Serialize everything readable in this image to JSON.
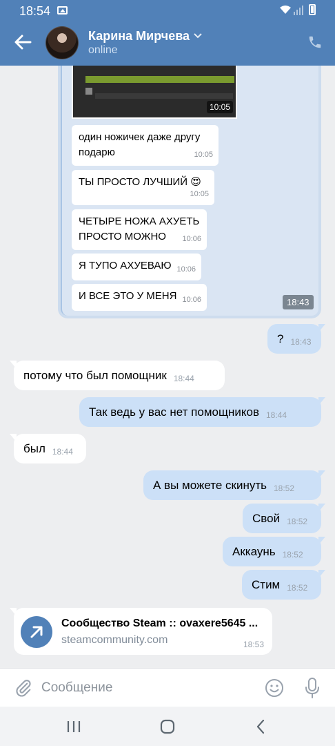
{
  "status_bar": {
    "time": "18:54"
  },
  "header": {
    "contact_name": "Карина Мирчева",
    "status": "online"
  },
  "forwarded": {
    "screenshot_time": "10:05",
    "messages": [
      {
        "text": "один ножичек даже другу подарю",
        "time": "10:05"
      },
      {
        "text": "ТЫ ПРОСТО ЛУЧШИЙ 😍",
        "time": "10:05"
      },
      {
        "text": "ЧЕТЫРЕ НОЖА АХУЕТЬ ПРОСТО МОЖНО",
        "time": "10:06"
      },
      {
        "text": "Я ТУПО АХУЕВАЮ",
        "time": "10:06"
      },
      {
        "text": "И ВСЕ ЭТО У МЕНЯ",
        "time": "10:06"
      }
    ],
    "forward_time": "18:43"
  },
  "messages": [
    {
      "dir": "out",
      "text": "?",
      "time": "18:43"
    },
    {
      "dir": "in",
      "text": "потому что был помощник",
      "time": "18:44"
    },
    {
      "dir": "out",
      "text": "Так ведь у вас нет помощников",
      "time": "18:44"
    },
    {
      "dir": "in",
      "text": "был",
      "time": "18:44"
    },
    {
      "dir": "out",
      "text": "А вы можете скинуть",
      "time": "18:52"
    },
    {
      "dir": "out",
      "text": "Свой",
      "time": "18:52"
    },
    {
      "dir": "out",
      "text": "Аккаунь",
      "time": "18:52"
    },
    {
      "dir": "out",
      "text": "Стим",
      "time": "18:52"
    }
  ],
  "link": {
    "title": "Сообщество Steam :: ovaxere5645 ...",
    "domain": "steamcommunity.com",
    "time": "18:53"
  },
  "composer": {
    "placeholder": "Сообщение"
  },
  "icons": [
    "back-arrow-icon",
    "chevron-down-icon",
    "phone-icon",
    "share-arrow-icon",
    "attach-icon",
    "emoji-icon",
    "mic-icon",
    "recent-apps-icon",
    "home-icon",
    "nav-back-icon"
  ],
  "colors": {
    "header": "#5181b8",
    "outgoing": "#cce0f7",
    "incoming": "#ffffff",
    "background": "#edeef0"
  }
}
